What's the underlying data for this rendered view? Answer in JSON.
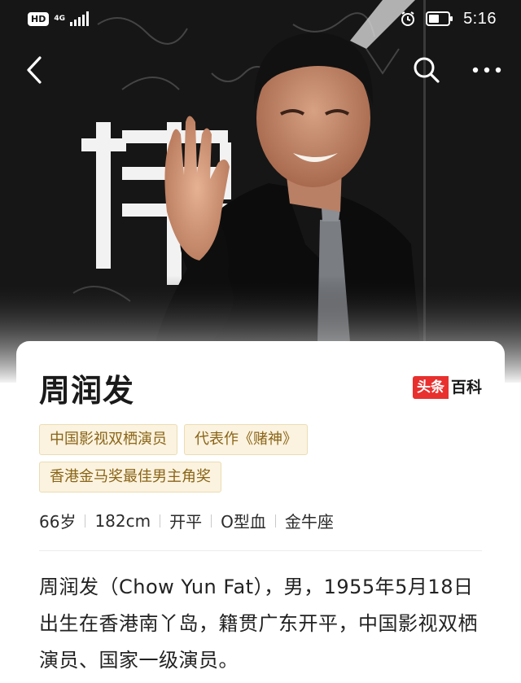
{
  "status_bar": {
    "hd": "HD",
    "network": "4G",
    "time": "5:16"
  },
  "nav": {
    "back_icon": "chevron-left-icon",
    "search_icon": "search-icon",
    "more_icon": "more-dots-icon"
  },
  "hero": {
    "image": "photo of Chow Yun Fat waving"
  },
  "card": {
    "name": "周润发",
    "brand_a": "头条",
    "brand_b": "百科",
    "tags": [
      "中国影视双栖演员",
      "代表作《赌神》",
      "香港金马奖最佳男主角奖"
    ],
    "facts": [
      "66岁",
      "182cm",
      "开平",
      "O型血",
      "金牛座"
    ],
    "intro": "周润发（Chow Yun Fat），男，1955年5月18日出生在香港南丫岛，籍贯广东开平，中国影视双栖演员、国家一级演员。"
  },
  "colors": {
    "brand_red": "#e8302e",
    "tag_bg": "#fbf3df",
    "tag_text": "#8a6418"
  }
}
